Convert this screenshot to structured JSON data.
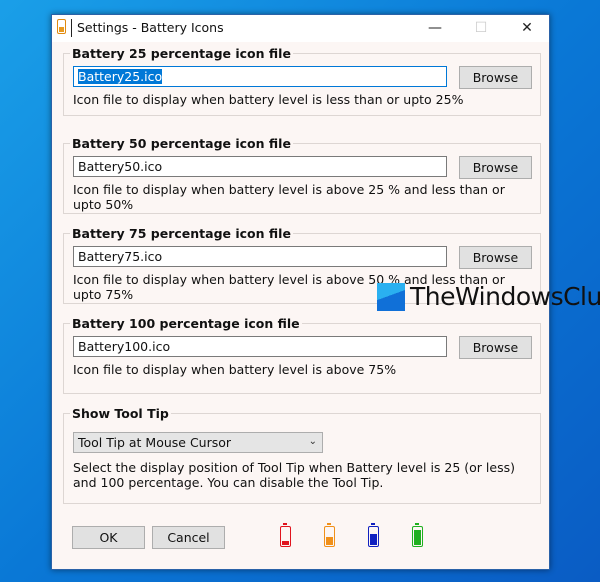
{
  "window": {
    "title": "Settings - Battery Icons",
    "minimize": "—",
    "maximize": "☐",
    "close": "✕"
  },
  "groups": [
    {
      "label": "Battery 25 percentage icon file",
      "value": "Battery25.ico",
      "browse": "Browse",
      "description": "Icon file to display when battery level is less than or upto 25%"
    },
    {
      "label": "Battery 50 percentage icon file",
      "value": "Battery50.ico",
      "browse": "Browse",
      "description": "Icon file to display when battery level is above 25 % and less than or upto 50%"
    },
    {
      "label": "Battery 75 percentage icon file",
      "value": "Battery75.ico",
      "browse": "Browse",
      "description": "Icon file to display when battery level is above 50 % and less than or upto 75%"
    },
    {
      "label": "Battery 100 percentage icon file",
      "value": "Battery100.ico",
      "browse": "Browse",
      "description": "Icon file to display when battery level is above 75%"
    }
  ],
  "tooltip": {
    "label": "Show Tool Tip",
    "selected": "Tool Tip at Mouse Cursor",
    "description": "Select the display position of Tool Tip when Battery level is 25 (or less) and 100 percentage. You can disable the Tool Tip."
  },
  "buttons": {
    "ok": "OK",
    "cancel": "Cancel"
  },
  "battery_icons": [
    {
      "name": "battery-25-icon",
      "color": "#e0141e",
      "level": 0.25
    },
    {
      "name": "battery-50-icon",
      "color": "#f0901a",
      "level": 0.5
    },
    {
      "name": "battery-75-icon",
      "color": "#1020c0",
      "level": 0.75
    },
    {
      "name": "battery-100-icon",
      "color": "#20b020",
      "level": 1.0
    }
  ],
  "watermark": "TheWindowsClub"
}
